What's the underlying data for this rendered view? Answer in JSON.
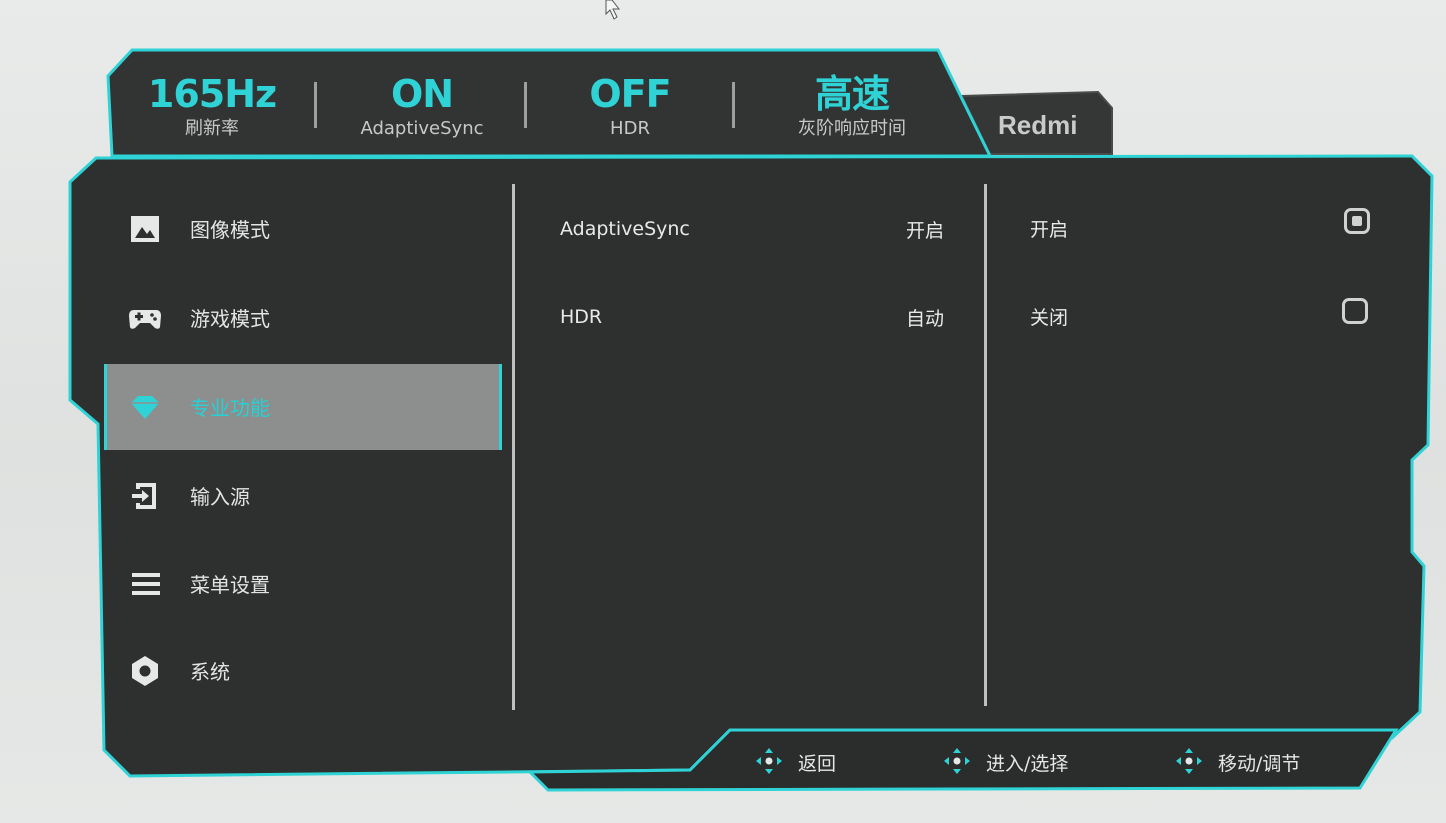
{
  "status_bar": [
    {
      "value": "165Hz",
      "label": "刷新率"
    },
    {
      "value": "ON",
      "label": "AdaptiveSync"
    },
    {
      "value": "OFF",
      "label": "HDR"
    },
    {
      "value": "高速",
      "label": "灰阶响应时间"
    }
  ],
  "brand": "Redmi",
  "sidebar": {
    "items": [
      {
        "label": "图像模式",
        "icon": "image-icon"
      },
      {
        "label": "游戏模式",
        "icon": "gamepad-icon"
      },
      {
        "label": "专业功能",
        "icon": "diamond-icon",
        "active": true
      },
      {
        "label": "输入源",
        "icon": "input-source-icon"
      },
      {
        "label": "菜单设置",
        "icon": "menu-icon"
      },
      {
        "label": "系统",
        "icon": "hexagon-icon"
      }
    ]
  },
  "settings": [
    {
      "label": "AdaptiveSync",
      "value": "开启"
    },
    {
      "label": "HDR",
      "value": "自动"
    }
  ],
  "options": [
    {
      "label": "开启",
      "selected": true
    },
    {
      "label": "关闭",
      "selected": false
    }
  ],
  "footer_hints": [
    {
      "label": "返回",
      "icon": "dpad-icon"
    },
    {
      "label": "进入/选择",
      "icon": "dpad-icon"
    },
    {
      "label": "移动/调节",
      "icon": "dpad-icon"
    }
  ],
  "colors": {
    "accent": "#2fd3d6",
    "panel": "#2f3030",
    "active_item": "#8d8f8f"
  }
}
